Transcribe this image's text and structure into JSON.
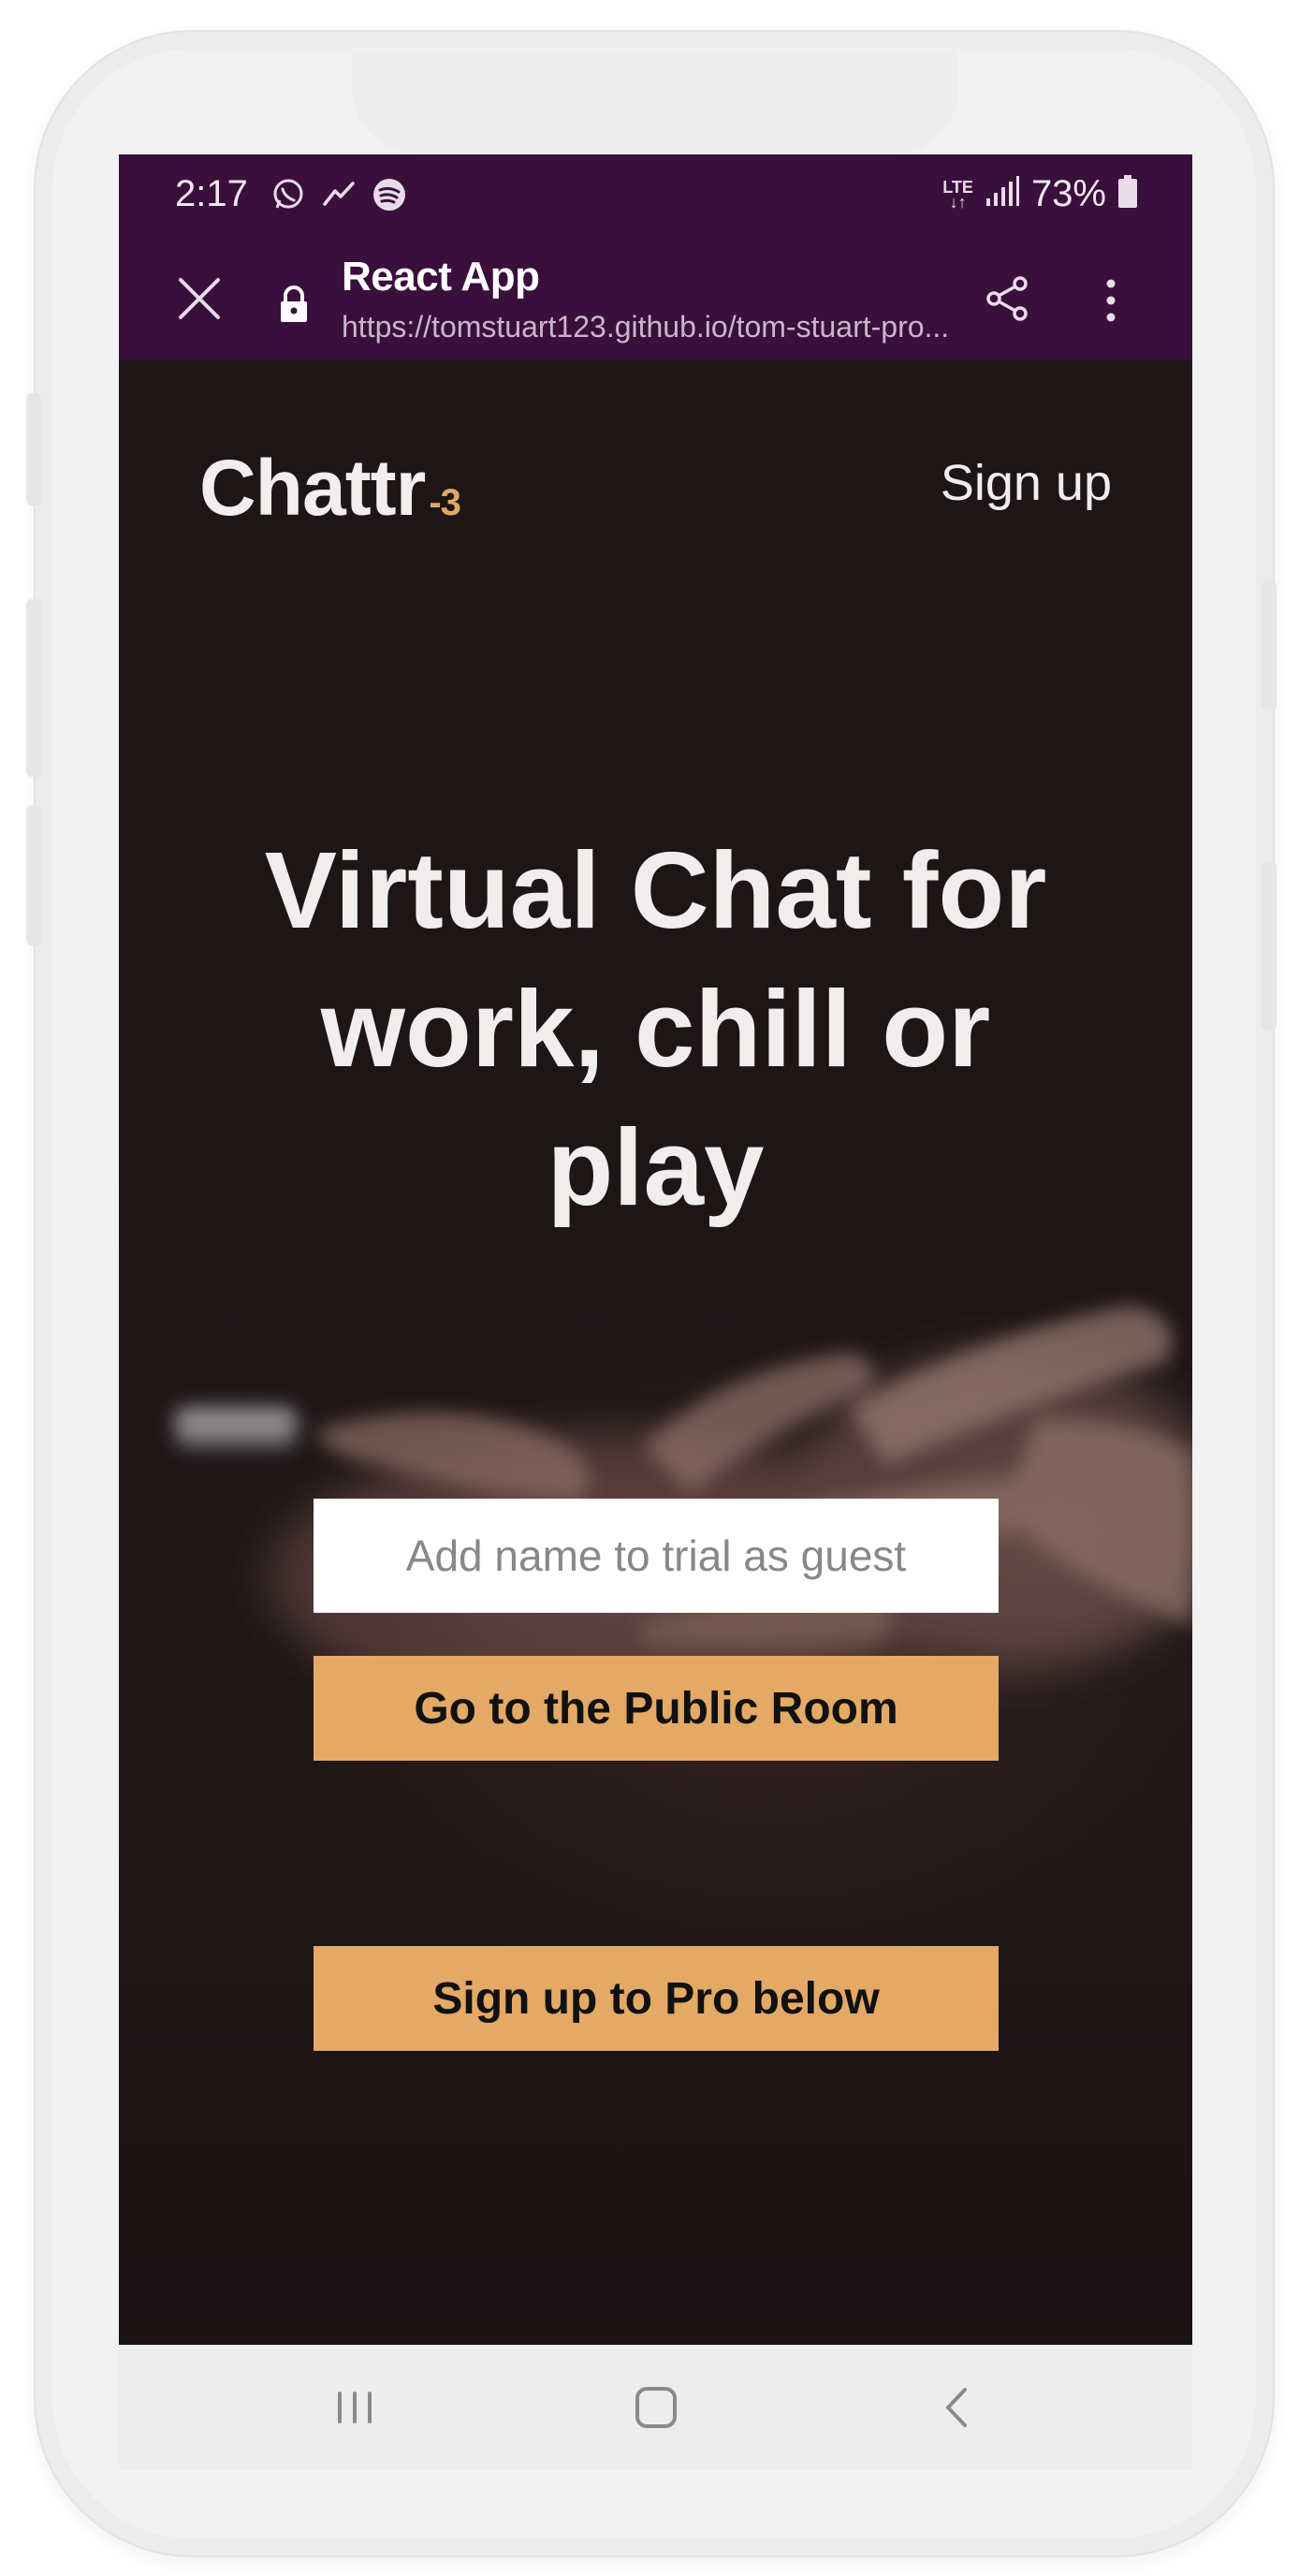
{
  "status_bar": {
    "time": "2:17",
    "network": "LTE",
    "battery": "73%",
    "icons": [
      "whatsapp-icon",
      "trend-icon",
      "spotify-icon",
      "lte-icon",
      "signal-icon",
      "battery-icon"
    ]
  },
  "browser": {
    "title": "React App",
    "url": "https://tomstuart123.github.io/tom-stuart-pro...",
    "icons": [
      "close-icon",
      "lock-icon",
      "share-icon",
      "more-vert-icon"
    ]
  },
  "header": {
    "logo": "Chattr",
    "logo_suffix": "-3",
    "signup_link": "Sign up"
  },
  "hero": {
    "title_line1": "Virtual Chat for",
    "title_line2": "work, chill or",
    "title_line3": "play"
  },
  "guest_form": {
    "name_placeholder": "Add name to trial as guest",
    "name_value": "",
    "public_room_button": "Go to the Public Room"
  },
  "pro": {
    "signup_button": "Sign up to Pro below"
  },
  "bottom_nav": {
    "icons": [
      "recent-apps-icon",
      "home-icon",
      "back-icon"
    ]
  },
  "colors": {
    "status_bar_bg": "#3a0f3c",
    "accent": "#e3a965",
    "page_bg": "#1c1415"
  }
}
